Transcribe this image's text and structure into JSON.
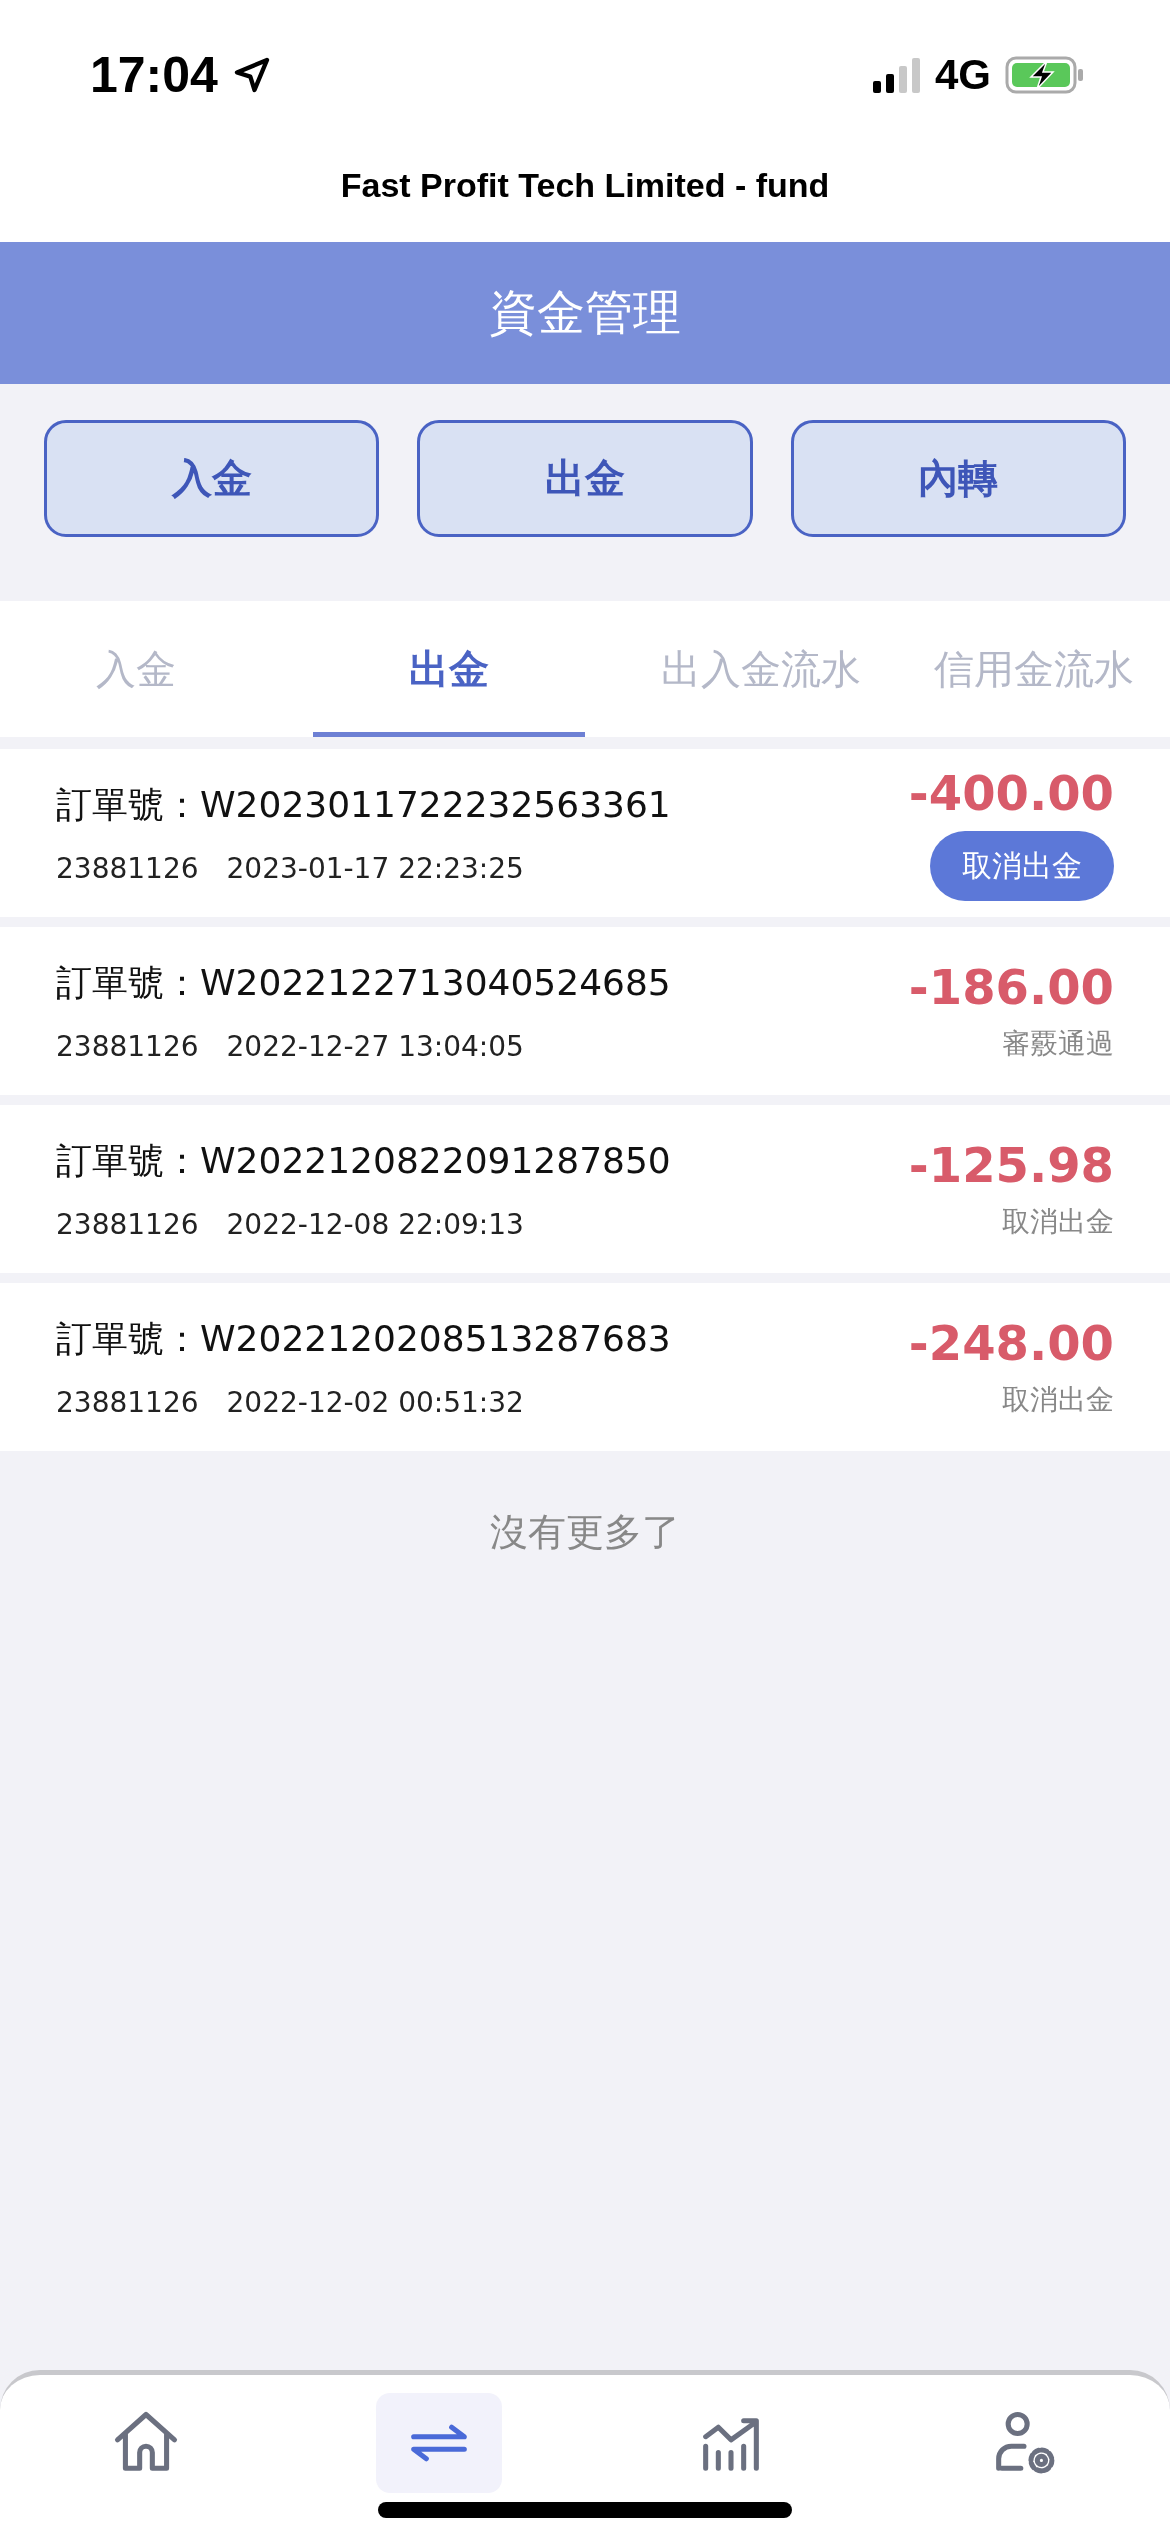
{
  "status_bar": {
    "time": "17:04",
    "network": "4G"
  },
  "app_title": "Fast Profit Tech Limited - fund",
  "header": {
    "title": "資金管理"
  },
  "actions": [
    {
      "label": "入金"
    },
    {
      "label": "出金"
    },
    {
      "label": "內轉"
    }
  ],
  "tabs": [
    {
      "label": "入金",
      "selected": false
    },
    {
      "label": "出金",
      "selected": true
    },
    {
      "label": "出入金流水",
      "selected": false
    },
    {
      "label": "信用金流水",
      "selected": false
    }
  ],
  "records": [
    {
      "order_label": "訂單號：",
      "order_no": "W2023011722232563361",
      "account": "23881126",
      "time": "2023-01-17 22:23:25",
      "amount": "-400.00",
      "status": {
        "kind": "button",
        "label": "取消出金"
      }
    },
    {
      "order_label": "訂單號：",
      "order_no": "W2022122713040524685",
      "account": "23881126",
      "time": "2022-12-27 13:04:05",
      "amount": "-186.00",
      "status": {
        "kind": "text",
        "label": "審覈通過"
      }
    },
    {
      "order_label": "訂單號：",
      "order_no": "W2022120822091287850",
      "account": "23881126",
      "time": "2022-12-08 22:09:13",
      "amount": "-125.98",
      "status": {
        "kind": "text",
        "label": "取消出金"
      }
    },
    {
      "order_label": "訂單號：",
      "order_no": "W2022120208513287683",
      "account": "23881126",
      "time": "2022-12-02 00:51:32",
      "amount": "-248.00",
      "status": {
        "kind": "text",
        "label": "取消出金"
      }
    }
  ],
  "list_end": "沒有更多了",
  "bottom_nav": [
    {
      "kind": "home",
      "selected": false
    },
    {
      "kind": "transfer",
      "selected": true
    },
    {
      "kind": "chart",
      "selected": false
    },
    {
      "kind": "account",
      "selected": false
    }
  ]
}
